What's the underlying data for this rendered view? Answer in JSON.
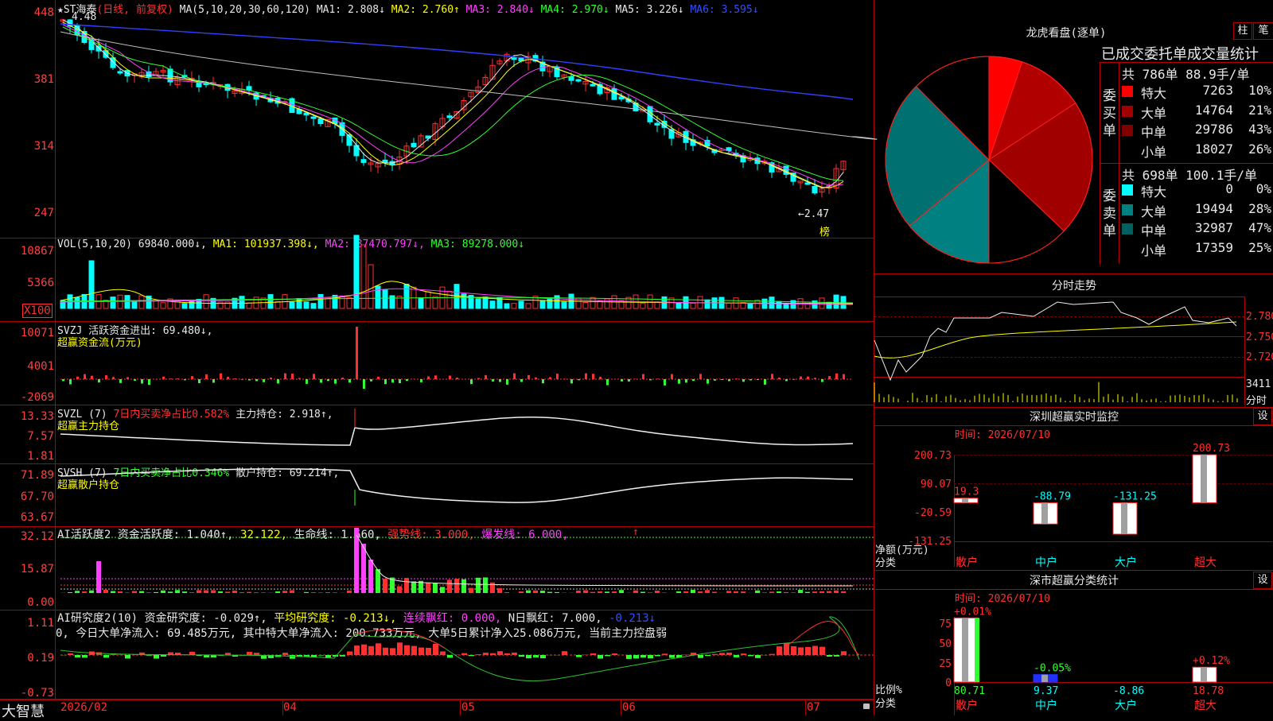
{
  "app": {
    "brand": "大智慧",
    "bottom_dates": [
      "2026/02",
      "04",
      "05",
      "06",
      "07"
    ]
  },
  "main": {
    "axis": [
      "448",
      "381",
      "314",
      "247"
    ],
    "header_prefix": "★ST海泰",
    "header_mode": "(日线, 前复权)",
    "header_ma_def": "MA(5,10,20,30,60,120)",
    "ma1": "MA1: 2.808↓",
    "ma2": "MA2: 2.760↑",
    "ma3": "MA3: 2.840↓",
    "ma4": "MA4: 2.970↓",
    "ma5": "MA5: 3.226↓",
    "ma6": "MA6: 3.595↓",
    "high_mark": "4.48",
    "low_mark": "←2.47",
    "rank_tag": "榜"
  },
  "vol": {
    "axis": [
      "10867",
      "5366"
    ],
    "unit": "X100",
    "label": "VOL(5,10,20)",
    "value": "69840.000↓",
    "ma1": "MA1: 101937.398↓",
    "ma2": "MA2: 87470.797↓",
    "ma3": "MA3: 89278.000↓"
  },
  "svzj": {
    "axis": [
      "10071",
      "4001",
      "-2069"
    ],
    "line1_a": "SVZJ",
    "line1_b": "活跃资金进出: 69.480↓,",
    "line2": "超赢资金流(万元)"
  },
  "svzl": {
    "axis": [
      "13.33",
      "7.57",
      "1.81"
    ],
    "line1_a": "SVZL (7)",
    "line1_b": "7日内买卖净占比0.582%",
    "line1_c": "主力持仓: 2.918↑,",
    "line2": "超赢主力持仓"
  },
  "svsh": {
    "axis": [
      "71.89",
      "67.70",
      "63.67"
    ],
    "line1_a": "SVSH (7)",
    "line1_b": "7日内买卖净占比0.346%",
    "line1_c": "散户持仓: 69.214↑,",
    "line2": "超赢散户持仓"
  },
  "ai1": {
    "axis": [
      "32.12",
      "15.87",
      "0.00"
    ],
    "a": "AI活跃度2",
    "b": "资金活跃度: 1.040↑,",
    "c": "32.122,",
    "d": "生命线: 1.560,",
    "e": "强势线: 3.000,",
    "f": "爆发线: 6.000,",
    "g": "↑"
  },
  "ai2": {
    "axis": [
      "1.11",
      "0.19",
      "-0.73"
    ],
    "a": "AI研究度2(10)",
    "b": "资金研究度: -0.029↑,",
    "c": "平均研究度: -0.213↓,",
    "d": "连续飘红: 0.000,",
    "e": "N日飘红: 7.000,",
    "f": "-0.213↓",
    "line2": "0, 今日大单净流入: 69.485万元, 其中特大单净流入: 200.733万元, 大单5日累计净入25.086万元, 当前主力控盘弱"
  },
  "dragon": {
    "title": "龙虎看盘(逐单)",
    "btn1": "柱",
    "btn2": "笔",
    "subtitle": "已成交委托单成交量统计",
    "buy_side": "委买单",
    "sell_side": "委卖单",
    "buy_total": "共 786单 88.9手/单",
    "sell_total": "共 698单 100.1手/单",
    "buy_rows": [
      {
        "name": "特大",
        "value": "7263",
        "pct": "10%",
        "color": "#ff0000"
      },
      {
        "name": "大单",
        "value": "14764",
        "pct": "21%",
        "color": "#a00000"
      },
      {
        "name": "中单",
        "value": "29786",
        "pct": "43%",
        "color": "#800000"
      },
      {
        "name": "小单",
        "value": "18027",
        "pct": "26%",
        "color": "#000000"
      }
    ],
    "sell_rows": [
      {
        "name": "特大",
        "value": "0",
        "pct": "0%",
        "color": "#00ffff"
      },
      {
        "name": "大单",
        "value": "19494",
        "pct": "28%",
        "color": "#008080"
      },
      {
        "name": "中单",
        "value": "32987",
        "pct": "47%",
        "color": "#006060"
      },
      {
        "name": "小单",
        "value": "17359",
        "pct": "25%",
        "color": "#000000"
      }
    ]
  },
  "intraday": {
    "title": "分时走势",
    "axis": [
      "2.780",
      "2.750",
      "2.720"
    ],
    "vol_label": "3411",
    "vol_unit": "分时"
  },
  "sz_monitor": {
    "title": "深圳超赢实时监控",
    "btn": "设",
    "time": "时间: 2026/07/10",
    "axis": [
      "200.73",
      "90.07",
      "-20.59",
      "-131.25"
    ],
    "ylabel": "净额(万元)",
    "xlabel": "分类",
    "bars": [
      {
        "cat": "散户",
        "value": "19.3"
      },
      {
        "cat": "中户",
        "value": "-88.79"
      },
      {
        "cat": "大户",
        "value": "-131.25"
      },
      {
        "cat": "超大",
        "value": "200.73"
      }
    ]
  },
  "sz_class": {
    "title": "深市超赢分类统计",
    "btn": "设",
    "time": "时间: 2026/07/10",
    "axis": [
      "75",
      "50",
      "25",
      "0"
    ],
    "ylabel": "比例%",
    "xlabel": "分类",
    "bars": [
      {
        "cat": "散户",
        "value": "80.71",
        "chg": "+0.01%"
      },
      {
        "cat": "中户",
        "value": "9.37",
        "chg": "-0.05%"
      },
      {
        "cat": "大户",
        "value": "-8.86",
        "chg": ""
      },
      {
        "cat": "超大",
        "value": "18.78",
        "chg": "+0.12%"
      }
    ]
  }
}
